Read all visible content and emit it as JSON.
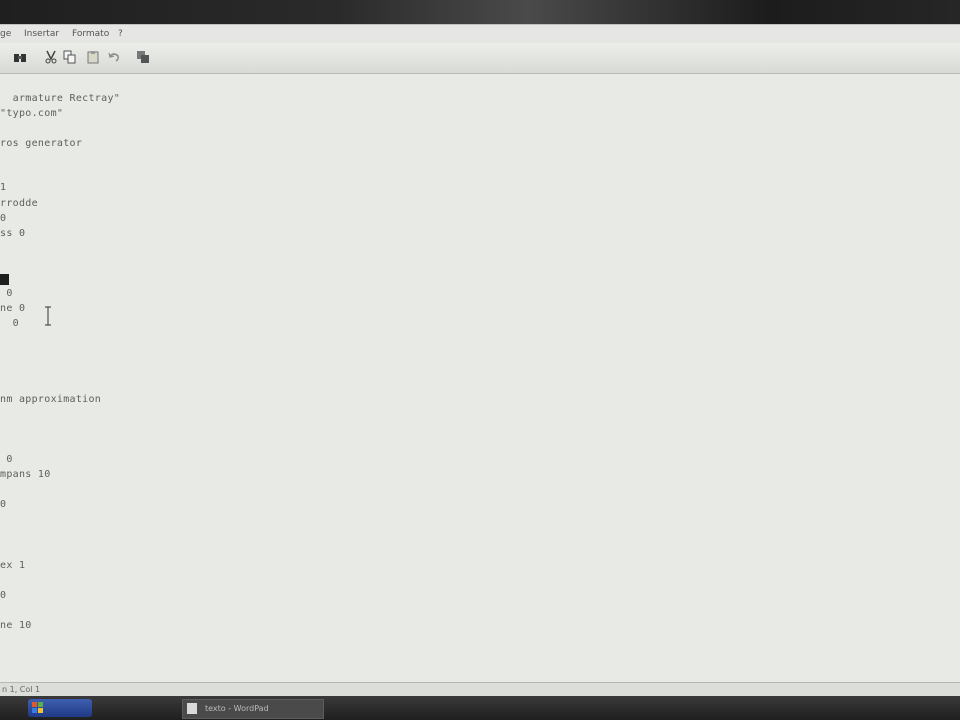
{
  "menubar": {
    "items": [
      "ge",
      "Insertar",
      "Formato",
      "?"
    ]
  },
  "toolbar": {
    "icons": [
      "find-icon",
      "cut-icon",
      "copy-icon",
      "paste-icon",
      "undo-icon",
      "replace-icon"
    ]
  },
  "editor": {
    "lines": [
      "  armature Rectray\"",
      "\"typo.com\"",
      "ros generator",
      "1",
      "rrodde",
      "0",
      "ss 0",
      " 0",
      "ne 0",
      "  0",
      "nm approximation",
      " 0",
      "mpans 10",
      "0",
      "ex 1",
      "0",
      "ne 10"
    ]
  },
  "statusbar": {
    "text": "n 1, Col 1"
  },
  "taskbar": {
    "start_label": "",
    "task_label": "texto - WordPad"
  },
  "colors": {
    "window_bg": "#e9ebe7",
    "taskbar": "#2a2a2a",
    "start_blue": "#2b4a9a"
  }
}
